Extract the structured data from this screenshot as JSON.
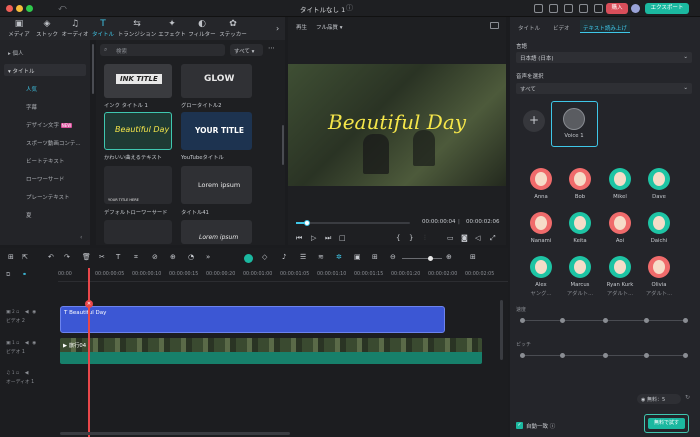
{
  "window": {
    "title": "タイトルなし 1",
    "buy_label": "購入",
    "export_label": "エクスポート"
  },
  "top_tabs": [
    {
      "label": "メディア",
      "glyph": "▣"
    },
    {
      "label": "ストック",
      "glyph": "◈"
    },
    {
      "label": "オーディオ",
      "glyph": "♫"
    },
    {
      "label": "タイトル",
      "glyph": "T"
    },
    {
      "label": "トランジション",
      "glyph": "⇆"
    },
    {
      "label": "エフェクト",
      "glyph": "✦"
    },
    {
      "label": "フィルター",
      "glyph": "◐"
    },
    {
      "label": "ステッカー",
      "glyph": "✿"
    }
  ],
  "left_nav": {
    "personal": "個人",
    "titles": "タイトル",
    "items": [
      "人気",
      "字幕",
      "デザイン文字",
      "スポーツ動画コンテ...",
      "ビートテキスト",
      "ローワーサード",
      "プレーンテキスト",
      "夏"
    ],
    "new_badge": "NEW"
  },
  "search": {
    "placeholder": "検索",
    "filter": "すべて"
  },
  "tiles": [
    {
      "thumb": "INK TITLE",
      "caption": "インク タイトル 1"
    },
    {
      "thumb": "GLOW",
      "caption": "グロータイトル2"
    },
    {
      "thumb": "Beautiful Day",
      "caption": "かわいい曲えるテキスト"
    },
    {
      "thumb": "YOUR TITLE",
      "caption": "YouTubeタイトル"
    },
    {
      "thumb": "YOUR TITLE HERE",
      "caption": "デフォルトローワーサード"
    },
    {
      "thumb": "Lorem ipsum",
      "caption": "タイトル41"
    },
    {
      "thumb": "Lorem ipsum",
      "caption": ""
    }
  ],
  "preview": {
    "tab_play": "再生",
    "quality": "フル品質",
    "overlay_text": "Beautiful Day",
    "current_time": "00:00:00:04",
    "total_time": "00:00:02:06",
    "progress": 0.1
  },
  "right_panel": {
    "tabs": [
      "タイトル",
      "ビデオ",
      "テキスト読み上げ"
    ],
    "language_label": "言語",
    "language_value": "日本語 (日本)",
    "voice_select_label": "音声を選択",
    "voice_filter": "すべて",
    "selected_voice": "Voice 1",
    "voices": [
      {
        "name": "Anna",
        "color": "#f06b6b"
      },
      {
        "name": "Bob",
        "color": "#f06b6b"
      },
      {
        "name": "Mikel",
        "color": "#1ec4a4"
      },
      {
        "name": "Dave",
        "color": "#1ec4a4"
      },
      {
        "name": "Nanami",
        "color": "#f06b6b"
      },
      {
        "name": "Keita",
        "color": "#1ec4a4"
      },
      {
        "name": "Aoi",
        "color": "#f06b6b"
      },
      {
        "name": "Daichi",
        "color": "#1ec4a4"
      },
      {
        "name": "Alex",
        "color": "#1ec4a4"
      },
      {
        "name": "Marcus",
        "color": "#1ec4a4"
      },
      {
        "name": "Ryan Kurk",
        "color": "#1ec4a4"
      },
      {
        "name": "Olivia",
        "color": "#f06b6b"
      }
    ],
    "voice_subs": [
      "ヤング...",
      "アダルト...",
      "アダルト...",
      "アダルト..."
    ],
    "speed_label": "速度",
    "pitch_label": "ピッチ",
    "credits": "無料：5",
    "auto_match": "自動一致",
    "try_free": "無料で試す"
  },
  "timeline": {
    "ticks": [
      "00:00",
      "00:00:00:05",
      "00:00:00:10",
      "00:00:00:15",
      "00:00:00:20",
      "00:00:01:00",
      "00:00:01:05",
      "00:00:01:10",
      "00:00:01:15",
      "00:00:01:20",
      "00:00:02:00",
      "00:00:02:05"
    ],
    "title_clip": "Beautiful Day",
    "video_clip": "旅行04",
    "track_video2": "ビデオ 2",
    "track_video1": "ビデオ 1",
    "track_audio1": "オーディオ 1"
  }
}
